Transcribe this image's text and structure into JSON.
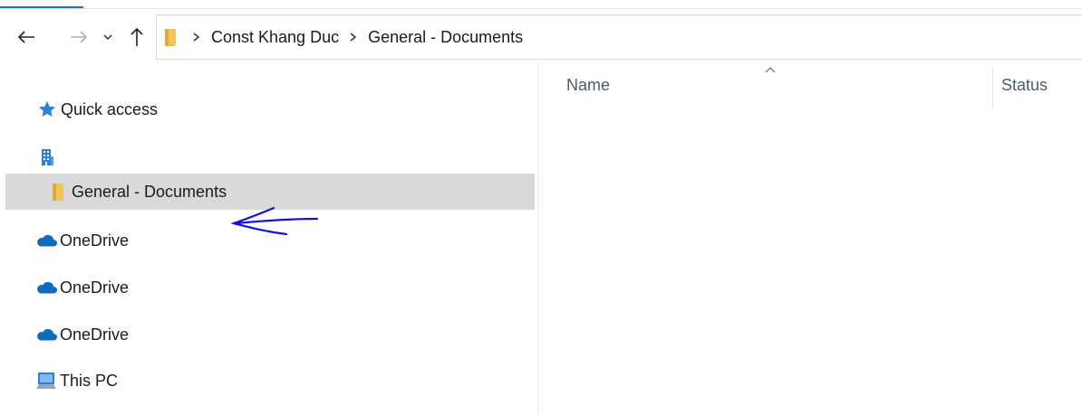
{
  "breadcrumb": [
    "Const Khang Duc",
    "General - Documents"
  ],
  "nav_pane": {
    "items": [
      {
        "label": "Quick access",
        "icon": "star-icon"
      },
      {
        "label": "",
        "icon": "building-icon"
      },
      {
        "label": "General - Documents",
        "icon": "folder-icon",
        "selected": true
      },
      {
        "label": "OneDrive",
        "icon": "onedrive-cloud-icon"
      },
      {
        "label": "OneDrive",
        "icon": "onedrive-cloud-icon"
      },
      {
        "label": "OneDrive",
        "icon": "onedrive-cloud-icon"
      },
      {
        "label": "This PC",
        "icon": "computer-icon"
      }
    ]
  },
  "columns": {
    "name": "Name",
    "status": "Status"
  },
  "colors": {
    "accent": "#1a6fd6",
    "selection": "#d9d9d9",
    "annotation": "#1010e0",
    "folder": "#f2c55c",
    "onedrive": "#0f6cbd"
  }
}
